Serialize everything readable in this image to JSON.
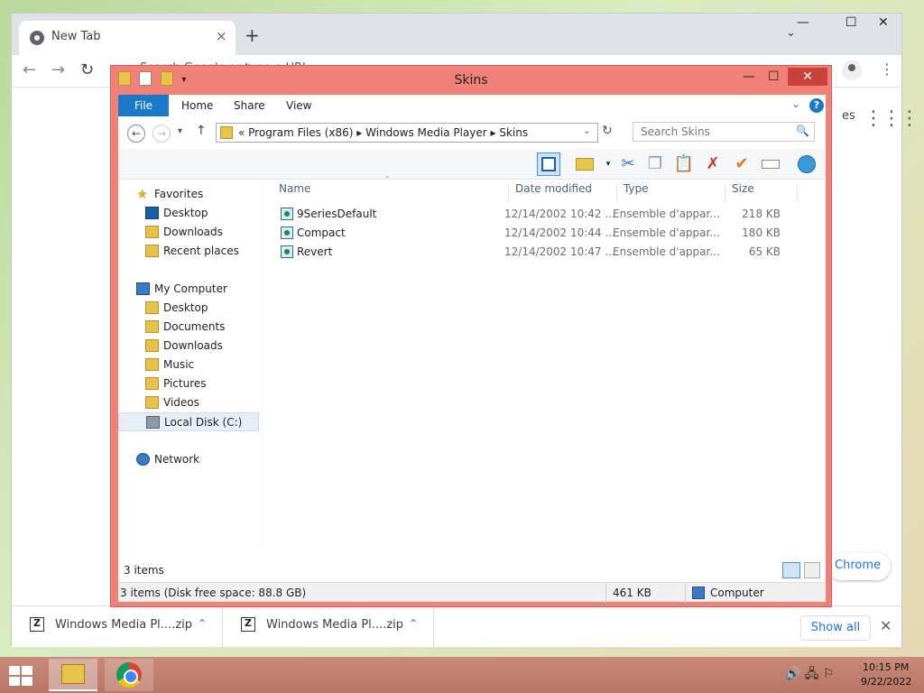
{
  "chrome": {
    "tab_title": "New Tab",
    "tab_close": "×",
    "new_tab": "+",
    "tab_menu": "⌄",
    "window_controls": {
      "minimize": "—",
      "maximize": "☐",
      "close": "✕"
    },
    "back": "←",
    "forward": "→",
    "reload": "↻",
    "omnibox_partial": "Search Google or type a URL",
    "kebab": "⋮",
    "apps_grid": "⋮⋮⋮",
    "partial_es": "es",
    "customize_chrome_partial": "Chrome"
  },
  "downloads": {
    "items": [
      {
        "name": "Windows Media Pl....zip",
        "chevron": "⌃"
      },
      {
        "name": "Windows Media Pl....zip",
        "chevron": "⌃"
      }
    ],
    "show_all": "Show all",
    "close": "✕"
  },
  "explorer": {
    "title": "Skins",
    "window_controls": {
      "minimize": "—",
      "maximize": "☐",
      "close": "✕"
    },
    "qat_dropdown": "▾",
    "ribbon_tabs": {
      "file": "File",
      "home": "Home",
      "share": "Share",
      "view": "View"
    },
    "ribbon_chevron": "⌄",
    "help": "?",
    "nav": {
      "back": "←",
      "forward": "→",
      "recent": "▾",
      "up": "↑"
    },
    "address": {
      "text": "« Program Files (x86) ▸ Windows Media Player ▸ Skins",
      "dropdown": "⌄",
      "refresh": "↻"
    },
    "search_placeholder": "Search Skins",
    "search_icon": "🔍",
    "toolbar": [
      "preview-pane",
      "new-folder",
      "dropdown",
      "cut",
      "copy",
      "paste",
      "delete",
      "properties",
      "rename",
      "web"
    ],
    "navpane": {
      "favorites": "Favorites",
      "favorites_items": [
        "Desktop",
        "Downloads",
        "Recent places"
      ],
      "computer": "My Computer",
      "computer_items": [
        "Desktop",
        "Documents",
        "Downloads",
        "Music",
        "Pictures",
        "Videos",
        "Local Disk (C:)"
      ],
      "network": "Network"
    },
    "columns": {
      "name": "Name",
      "date": "Date modified",
      "type": "Type",
      "size": "Size"
    },
    "sort_arrow": "˄",
    "files": [
      {
        "name": "9SeriesDefault",
        "date": "12/14/2002 10:42 ...",
        "type": "Ensemble d'appar...",
        "size": "218 KB"
      },
      {
        "name": "Compact",
        "date": "12/14/2002 10:44 ...",
        "type": "Ensemble d'appar...",
        "size": "180 KB"
      },
      {
        "name": "Revert",
        "date": "12/14/2002 10:47 ...",
        "type": "Ensemble d'appar...",
        "size": "65 KB"
      }
    ],
    "item_count": "3 items",
    "status": {
      "disk": "3 items (Disk free space: 88.8 GB)",
      "size": "461 KB",
      "location": "Computer"
    }
  },
  "taskbar": {
    "clock_time": "10:15 PM",
    "clock_date": "9/22/2022",
    "tray": "🔊 🖧 ⚐"
  }
}
